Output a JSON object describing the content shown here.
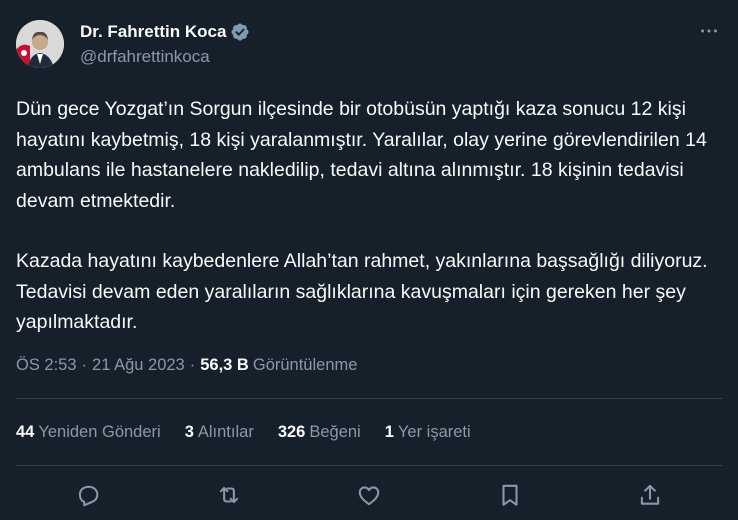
{
  "author": {
    "name": "Dr. Fahrettin Koca",
    "handle": "@drfahrettinkoca"
  },
  "tweet": {
    "paragraphs": [
      "Dün gece Yozgat’ın Sorgun ilçesinde bir otobüsün yaptığı kaza sonucu 12 kişi hayatını kaybetmiş, 18 kişi yaralanmıştır. Yaralılar, olay yerine görevlendirilen 14 ambulans ile hastanelere nakledilip, tedavi altına alınmıştır. 18 kişinin tedavisi devam etmektedir.",
      "Kazada hayatını kaybedenlere Allah’tan rahmet, yakınlarına başsağlığı diliyoruz. Tedavisi devam eden yaralıların sağlıklarına kavuşmaları için gereken her şey yapılmaktadır."
    ],
    "time": "ÖS 2:53",
    "date": "21 Ağu 2023",
    "views_count": "56,3 B",
    "views_label": "Görüntülenme"
  },
  "stats": {
    "retweets": {
      "count": "44",
      "label": "Yeniden Gönderi"
    },
    "quotes": {
      "count": "3",
      "label": "Alıntılar"
    },
    "likes": {
      "count": "326",
      "label": "Beğeni"
    },
    "bookmarks": {
      "count": "1",
      "label": "Yer işareti"
    }
  },
  "icons": {
    "verified": "verified-badge-icon",
    "more": "more-horizontal-icon",
    "reply": "reply-icon",
    "retweet": "retweet-icon",
    "like": "heart-icon",
    "bookmark": "bookmark-icon",
    "share": "share-icon"
  },
  "colors": {
    "background": "#15202b",
    "text": "#f7f9f9",
    "secondary": "#8b98a5",
    "divider": "#38444d",
    "verified": "#829aab"
  }
}
